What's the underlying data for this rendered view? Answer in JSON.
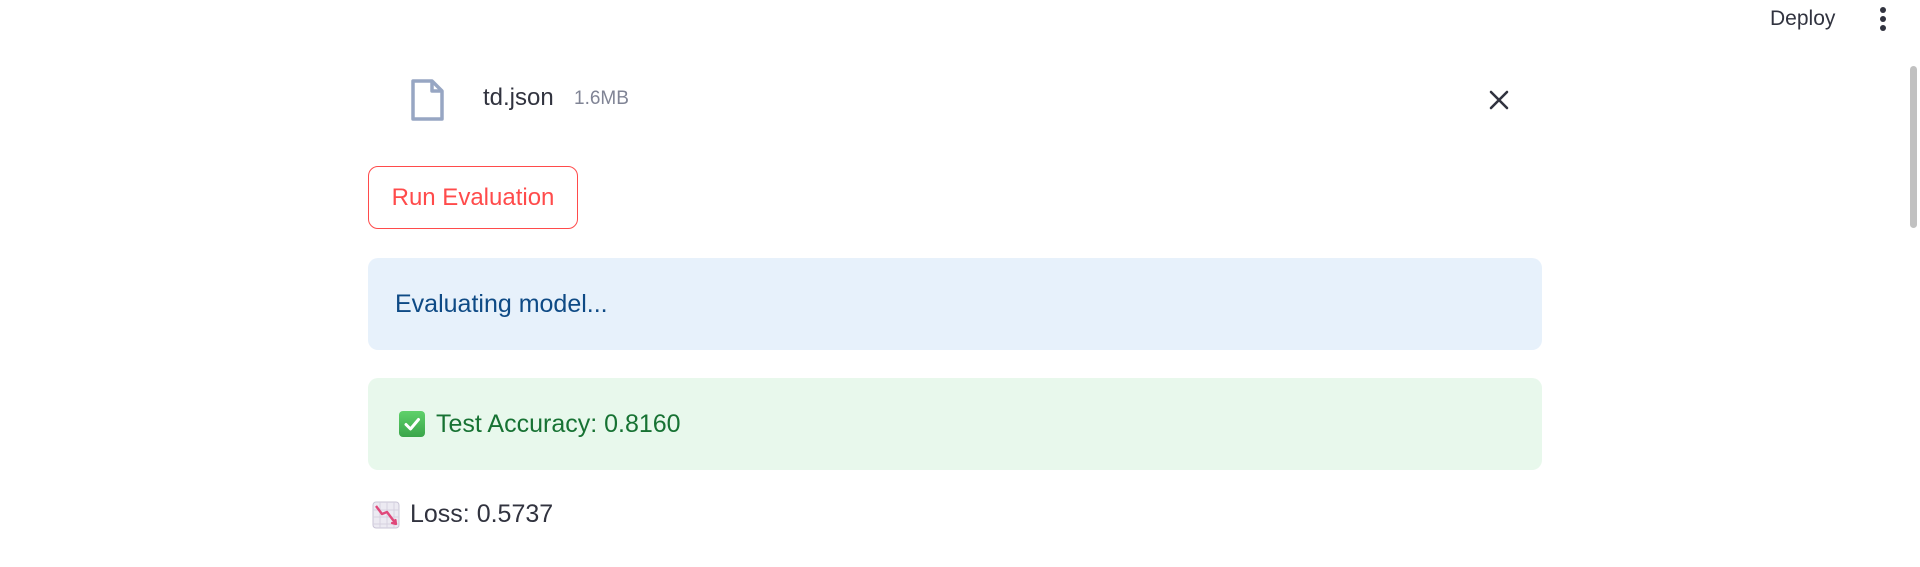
{
  "header": {
    "deploy_label": "Deploy",
    "menu_icon": "vertical-ellipsis-icon"
  },
  "uploaded_file": {
    "icon": "file-icon",
    "name": "td.json",
    "size": "1.6MB",
    "remove_icon": "close-icon"
  },
  "actions": {
    "run_label": "Run Evaluation"
  },
  "status": {
    "info_text": "Evaluating model...",
    "success_icon": "check-mark-button-icon",
    "success_text": "Test Accuracy: 0.8160",
    "loss_icon": "chart-decreasing-icon",
    "loss_text": "Loss: 0.5737"
  },
  "colors": {
    "primary": "#ff4b4b",
    "info_bg": "#e7f1fb",
    "info_text": "#0e4a85",
    "success_bg": "#e8f8ec",
    "success_text": "#177233",
    "text": "#31333f"
  }
}
